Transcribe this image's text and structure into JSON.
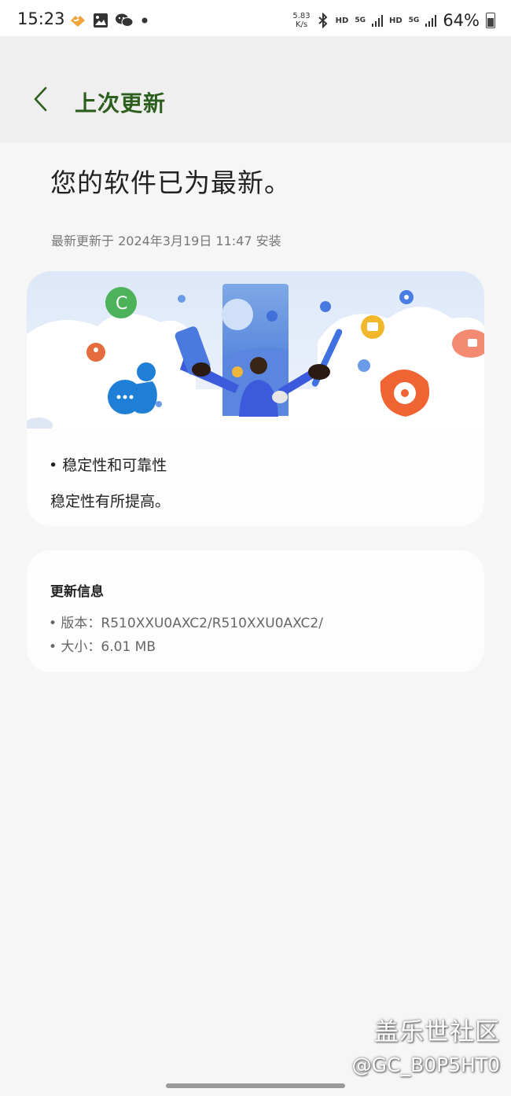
{
  "status_bar": {
    "time": "15:23",
    "speed_value": "5.83",
    "speed_unit": "K/s",
    "hd_1": "HD",
    "net_1": "5G",
    "hd_2": "HD",
    "net_2": "5G",
    "battery": "64%"
  },
  "header": {
    "title": "上次更新"
  },
  "main": {
    "headline": "您的软件已为最新。",
    "updated_at": "最新更新于 2024年3月19日 11:47 安装"
  },
  "update_card": {
    "bullet": "• 稳定性和可靠性",
    "description": "稳定性有所提高。"
  },
  "info_card": {
    "title": "更新信息",
    "version": "• 版本：R510XXU0AXC2/R510XXU0AXC2/",
    "size": "• 大小：6.01 MB"
  },
  "watermark": {
    "line1": "盖乐世社区",
    "line2": "@GC_B0P5HT0"
  },
  "colors": {
    "title_green": "#2c5e1e",
    "background": "#f6f6f6",
    "card": "#fdfdfd"
  }
}
